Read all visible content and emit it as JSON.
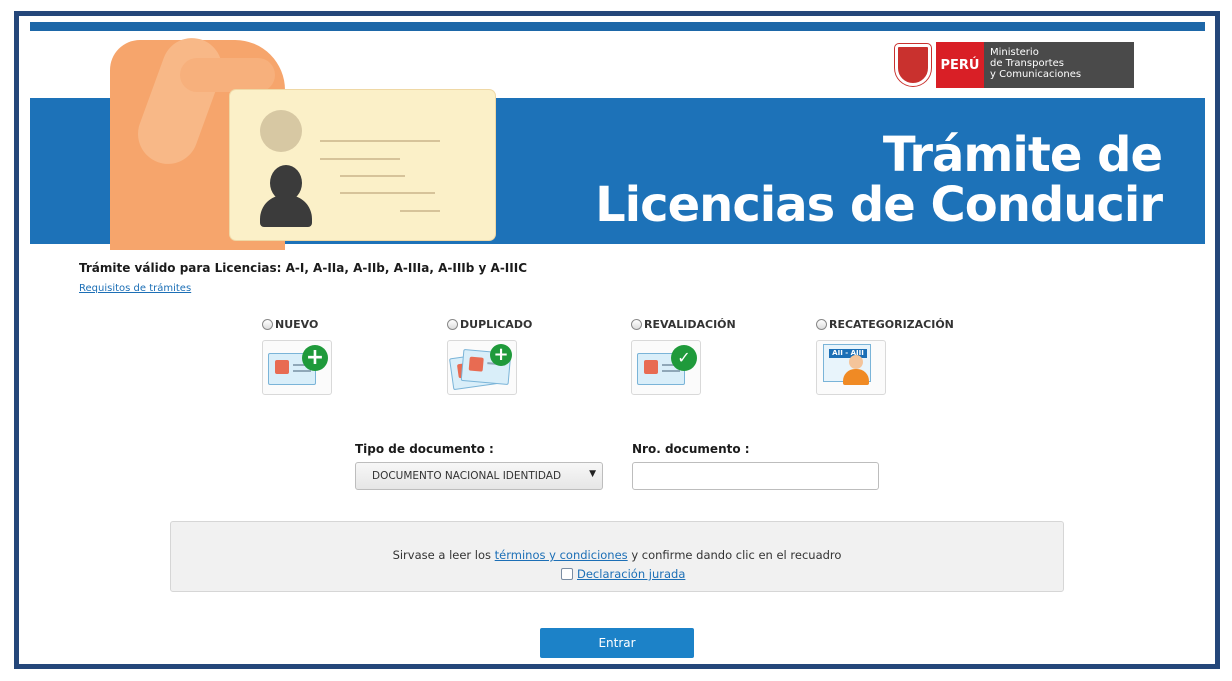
{
  "header": {
    "logo_country": "PERÚ",
    "logo_ministry": [
      "Ministerio",
      "de Transportes",
      "y Comunicaciones"
    ],
    "banner_title_line1": "Trámite de",
    "banner_title_line2": "Licencias de Conducir"
  },
  "content": {
    "valid_text": "Trámite válido para Licencias: A-I, A-IIa, A-IIb, A-IIIa, A-IIIb y A-IIIC",
    "requirements_link": "Requisitos de trámites",
    "options": [
      {
        "label": "NUEVO",
        "icon": "new-license-icon"
      },
      {
        "label": "DUPLICADO",
        "icon": "duplicate-license-icon"
      },
      {
        "label": "REVALIDACIÓN",
        "icon": "revalidation-icon"
      },
      {
        "label": "RECATEGORIZACIÓN",
        "icon": "recategorization-icon"
      }
    ],
    "recat_card_text": "AII - AIII",
    "doc_type_label": "Tipo de documento :",
    "doc_type_value": "DOCUMENTO NACIONAL IDENTIDAD",
    "doc_number_label": "Nro. documento :",
    "doc_number_value": ""
  },
  "terms": {
    "text_before": "Sirvase a leer los ",
    "link_text": "términos y condiciones",
    "text_after": " y confirme dando clic en el recuadro",
    "declaration_label": "Declaración jurada"
  },
  "actions": {
    "enter_label": "Entrar"
  },
  "colors": {
    "brand_blue": "#1d72b8",
    "frame_border": "#24477a",
    "button_blue": "#1c82c8",
    "peru_red": "#d91f26"
  }
}
